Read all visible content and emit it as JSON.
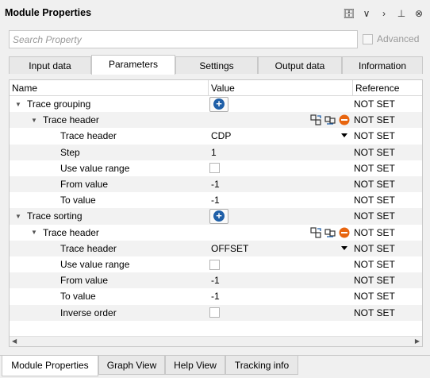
{
  "window": {
    "title": "Module Properties"
  },
  "titlebar_icons": [
    {
      "name": "database-icon",
      "glyph": "🗄"
    },
    {
      "name": "chevron-down-icon",
      "glyph": "∨"
    },
    {
      "name": "chevron-right-icon",
      "glyph": "›"
    },
    {
      "name": "pin-icon",
      "glyph": "⊥"
    },
    {
      "name": "close-icon",
      "glyph": "⊗"
    }
  ],
  "search": {
    "placeholder": "Search Property",
    "advanced_label": "Advanced"
  },
  "tabs": [
    "Input data",
    "Parameters",
    "Settings",
    "Output data",
    "Information"
  ],
  "active_tab": "Parameters",
  "columns": {
    "name": "Name",
    "value": "Value",
    "reference": "Reference"
  },
  "rows": [
    {
      "level": 0,
      "arrow": "▼",
      "name": "Trace grouping",
      "type": "plus",
      "ref": "NOT SET"
    },
    {
      "level": 1,
      "arrow": "▼",
      "name": "Trace header",
      "type": "header-icons",
      "ref": "NOT SET"
    },
    {
      "level": 2,
      "name": "Trace header",
      "type": "dropdown",
      "value": "CDP",
      "ref": "NOT SET"
    },
    {
      "level": 2,
      "name": "Step",
      "type": "text",
      "value": "1",
      "ref": "NOT SET"
    },
    {
      "level": 2,
      "name": "Use value range",
      "type": "checkbox",
      "ref": "NOT SET"
    },
    {
      "level": 2,
      "name": "From value",
      "type": "text",
      "value": "-1",
      "ref": "NOT SET"
    },
    {
      "level": 2,
      "name": "To value",
      "type": "text",
      "value": "-1",
      "ref": "NOT SET"
    },
    {
      "level": 0,
      "arrow": "▼",
      "name": "Trace sorting",
      "type": "plus",
      "ref": "NOT SET"
    },
    {
      "level": 1,
      "arrow": "▼",
      "name": "Trace header",
      "type": "header-icons",
      "ref": "NOT SET"
    },
    {
      "level": 2,
      "name": "Trace header",
      "type": "dropdown",
      "value": "OFFSET",
      "ref": "NOT SET"
    },
    {
      "level": 2,
      "name": "Use value range",
      "type": "checkbox",
      "ref": "NOT SET"
    },
    {
      "level": 2,
      "name": "From value",
      "type": "text",
      "value": "-1",
      "ref": "NOT SET"
    },
    {
      "level": 2,
      "name": "To value",
      "type": "text",
      "value": "-1",
      "ref": "NOT SET"
    },
    {
      "level": 2,
      "name": "Inverse order",
      "type": "checkbox",
      "ref": "NOT SET"
    }
  ],
  "bottom_tabs": [
    "Module Properties",
    "Graph View",
    "Help View",
    "Tracking info"
  ],
  "active_bottom_tab": "Module Properties",
  "colors": {
    "plus_button": "#1f5fa8",
    "remove_icon": "#e8650f",
    "row_alt": "#f2f2f2"
  }
}
